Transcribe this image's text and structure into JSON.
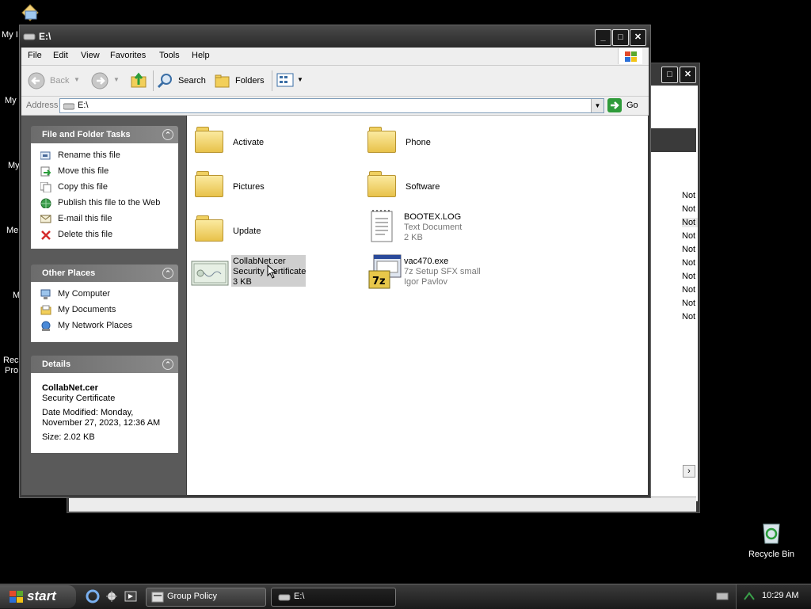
{
  "desktop": {
    "left_labels": [
      "My I",
      "My",
      "My",
      "Me",
      "M",
      "Rec",
      "Pro"
    ],
    "recycle_bin": "Recycle Bin"
  },
  "background_window": {
    "rows": [
      "Not",
      "Not",
      "Not",
      "Not",
      "Not",
      "Not",
      "Not",
      "Not",
      "Not",
      "Not"
    ],
    "scroll_arrow": "›"
  },
  "window": {
    "title": "E:\\",
    "buttons": {
      "minimize": "_",
      "maximize": "□",
      "close": "✕"
    },
    "menu": [
      "File",
      "Edit",
      "View",
      "Favorites",
      "Tools",
      "Help"
    ],
    "toolbar": {
      "back": "Back",
      "search": "Search",
      "folders": "Folders"
    },
    "address": {
      "label": "Address",
      "value": "E:\\",
      "go": "Go"
    }
  },
  "left_pane": {
    "file_tasks": {
      "title": "File and Folder Tasks",
      "items": [
        {
          "label": "Rename this file",
          "icon": "rename-icon"
        },
        {
          "label": "Move this file",
          "icon": "move-icon"
        },
        {
          "label": "Copy this file",
          "icon": "copy-icon"
        },
        {
          "label": "Publish this file to the Web",
          "icon": "globe-icon"
        },
        {
          "label": "E-mail this file",
          "icon": "email-icon"
        },
        {
          "label": "Delete this file",
          "icon": "delete-icon"
        }
      ]
    },
    "other_places": {
      "title": "Other Places",
      "items": [
        {
          "label": "My Computer",
          "icon": "computer-icon"
        },
        {
          "label": "My Documents",
          "icon": "documents-icon"
        },
        {
          "label": "My Network Places",
          "icon": "network-icon"
        }
      ]
    },
    "details": {
      "title": "Details",
      "name": "CollabNet.cer",
      "type": "Security Certificate",
      "date_line1": "Date Modified: Monday,",
      "date_line2": "November 27, 2023, 12:36 AM",
      "size": "Size: 2.02 KB"
    }
  },
  "files": [
    {
      "name": "Activate",
      "kind": "folder"
    },
    {
      "name": "Phone",
      "kind": "folder"
    },
    {
      "name": "Pictures",
      "kind": "folder"
    },
    {
      "name": "Software",
      "kind": "folder"
    },
    {
      "name": "Update",
      "kind": "folder"
    },
    {
      "name": "BOOTEX.LOG",
      "kind": "text",
      "line2": "Text Document",
      "line3": "2 KB"
    },
    {
      "name": "CollabNet.cer",
      "kind": "certificate",
      "line2": "Security Certificate",
      "line3": "3 KB",
      "selected": true
    },
    {
      "name": "vac470.exe",
      "kind": "exe",
      "line2": "7z Setup SFX small",
      "line3": "Igor Pavlov"
    }
  ],
  "taskbar": {
    "start": "start",
    "tasks": [
      "Group Policy",
      "E:\\"
    ],
    "clock": "10:29 AM"
  }
}
